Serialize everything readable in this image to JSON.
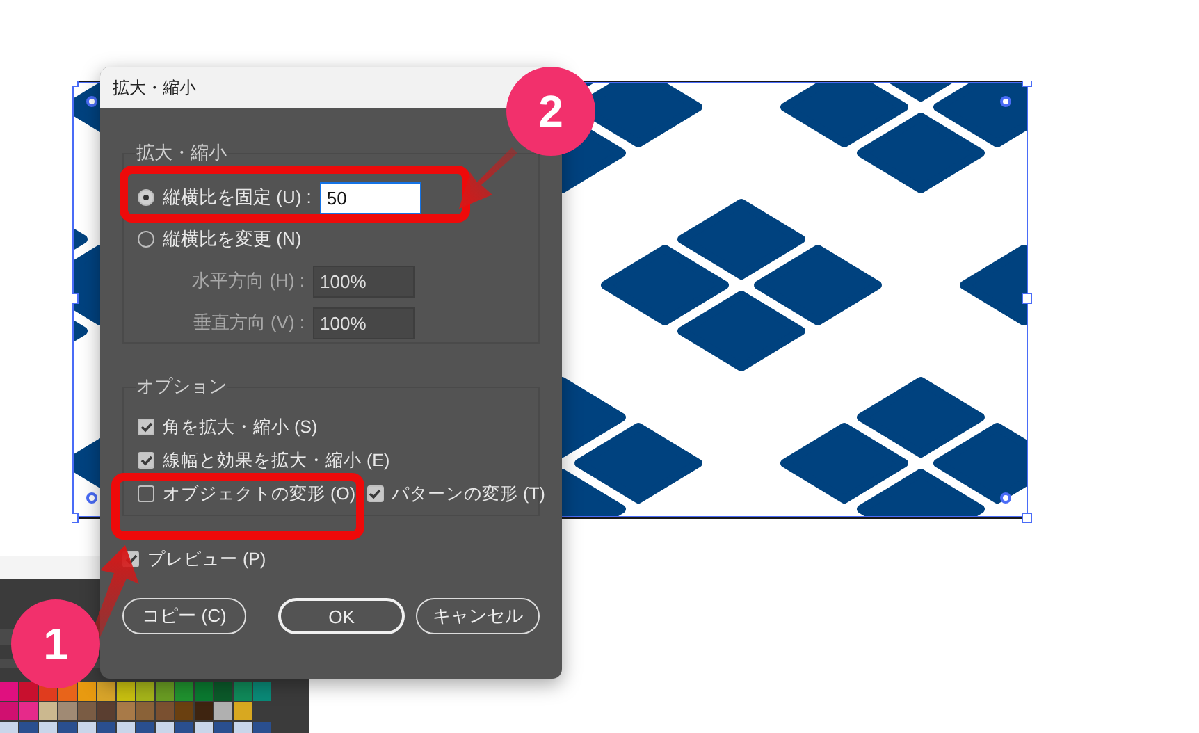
{
  "dialog": {
    "title": "拡大・縮小",
    "scale_group": {
      "label": "拡大・縮小",
      "options": [
        {
          "kind": "uniform",
          "label": "縦横比を固定 (U) :",
          "selected": true,
          "value": "50"
        },
        {
          "kind": "non_uniform",
          "label": "縦横比を変更 (N)",
          "selected": false,
          "fields": [
            {
              "label": "水平方向 (H) :",
              "value": "100%",
              "disabled": true
            },
            {
              "label": "垂直方向 (V) :",
              "value": "100%",
              "disabled": true
            }
          ]
        }
      ]
    },
    "options_group": {
      "label": "オプション",
      "checkbox_rows": [
        [
          {
            "label": "角を拡大・縮小 (S)",
            "checked": true
          }
        ],
        [
          {
            "label": "線幅と効果を拡大・縮小 (E)",
            "checked": true
          }
        ],
        [
          {
            "label": "オブジェクトの変形 (O)",
            "checked": false
          },
          {
            "label": "パターンの変形 (T)",
            "checked": true
          }
        ]
      ]
    },
    "preview": {
      "label": "プレビュー (P)",
      "checked": true
    },
    "buttons": [
      {
        "label": "コピー (C)",
        "default": false
      },
      {
        "label": "OK",
        "default": true
      },
      {
        "label": "キャンセル",
        "default": false
      }
    ]
  },
  "callouts": [
    {
      "number": "1"
    },
    {
      "number": "2"
    }
  ]
}
